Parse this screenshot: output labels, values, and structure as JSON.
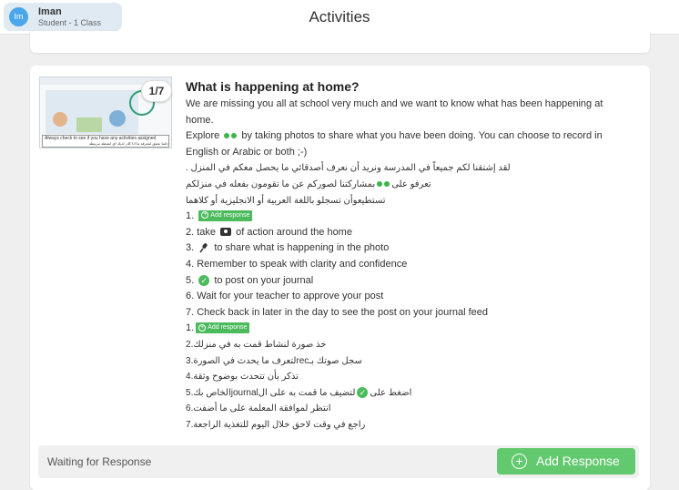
{
  "header": {
    "user": {
      "initials": "Im",
      "name": "Iman",
      "role": "Student - 1 Class"
    },
    "title": "Activities"
  },
  "activity": {
    "thumbnail": {
      "badge": "1/7",
      "caption_en": "Always check to see if you have any activities assigned",
      "caption_ar": "دائما تحقق لمعرفة ما اذا كان لديك اي انشطة مرتبطة"
    },
    "title": "What is happening at home?",
    "intro": [
      "We are missing you all at school very much and we want to know what has been happening at",
      "home.",
      "Explore",
      "by taking photos to share what you have been doing. You can choose to record in",
      "English or Arabic or both ;-)"
    ],
    "arabic_intro": [
      "لقد إشتقنا لكم جميعاً في المدرسة ونريد أن نعرف أصدقائي ما يحصل معكم في المنزل .",
      "تعرفو على",
      "بمشاركتنا لصوركم عن ما تقومون بفعله في منزلكم",
      "تستطيعوأن تسجلو باللغة العربية أو الانجليزية أو كلاهما"
    ],
    "steps_en": {
      "s1_prefix": "1.",
      "s2_prefix": "2. take",
      "s2_suffix": "of action around the home",
      "s3_prefix": "3.",
      "s3_suffix": "to share what is happening in the photo",
      "s4": "4. Remember to speak with clarity and confidence",
      "s5_prefix": "5.",
      "s5_suffix": "to post on your journal",
      "s6": "6. Wait for your teacher to approve your post",
      "s7": "7. Check back in later in the day to see the post on your journal feed"
    },
    "steps_ar": {
      "s1_prefix": "1.",
      "s2": "خذ صورة لنشاط قمت به في منزلك.2",
      "s3": "سجل صوتك بـrecلتعرف ما يحدث في الصورة.3",
      "s4": "تذكر بأن تتحدث بوضوح وثقة.4",
      "s5_left": "اضغط على",
      "s5_right": "لتضيف ما قمت به على الjournalالخاص بك.5",
      "s6": "انتظر لموافقة المعلمة على ما أضفت.6",
      "s7": "راجع في وقت لاحق خلال اليوم للتغذية الراجعة.7"
    },
    "mini_add_label": "Add response",
    "footer": {
      "status": "Waiting for Response",
      "add_button": "Add Response"
    }
  },
  "colors": {
    "accent_green": "#62c96e",
    "avatar_blue": "#4aa6ea"
  },
  "icons": [
    "glasses-icon",
    "camera-icon",
    "microphone-icon",
    "checkmark-icon",
    "plus-circle-icon"
  ]
}
